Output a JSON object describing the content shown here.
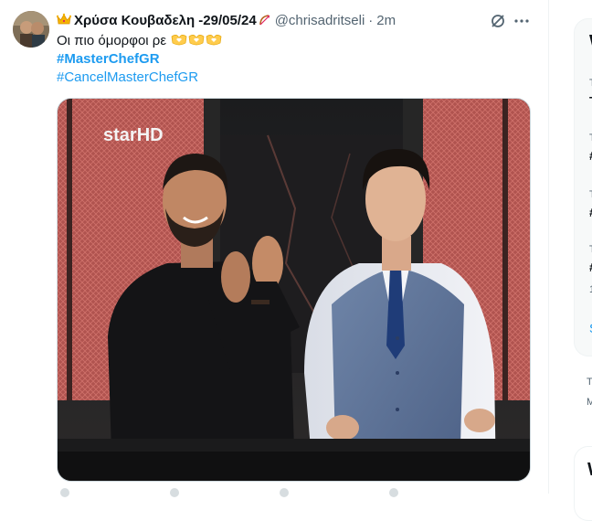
{
  "tweet": {
    "display_name": "Χρύσα Κουβαδελη -29/05/24",
    "handle": "@chrisadritseli",
    "dot": "·",
    "time": "2m",
    "text": "Οι πιο όμορφοι ρε",
    "hashtag1": "#MasterChefGR",
    "hashtag2": "#CancelMasterChefGR",
    "media_watermark": "starHD"
  },
  "icons": {
    "crown": "crown-emoji-icon",
    "badge": "bow-arrow-emoji-icon",
    "hearts": "heart-hands-emoji-icon",
    "grok": "grok-icon",
    "more": "more-icon"
  },
  "sidebar": {
    "card_title_initial": "W",
    "rows": [
      {
        "small": "T",
        "bold": "T"
      },
      {
        "small": "T",
        "bold": "#"
      },
      {
        "small": "T",
        "bold": "#"
      },
      {
        "small": "T",
        "bold": "#",
        "extra": "1"
      }
    ],
    "show_more_initial": "S",
    "footer1": "T",
    "footer2": "M",
    "card2_initial": "W"
  },
  "colors": {
    "accent": "#1d9bf0",
    "text": "#0f1419",
    "muted": "#536471"
  }
}
